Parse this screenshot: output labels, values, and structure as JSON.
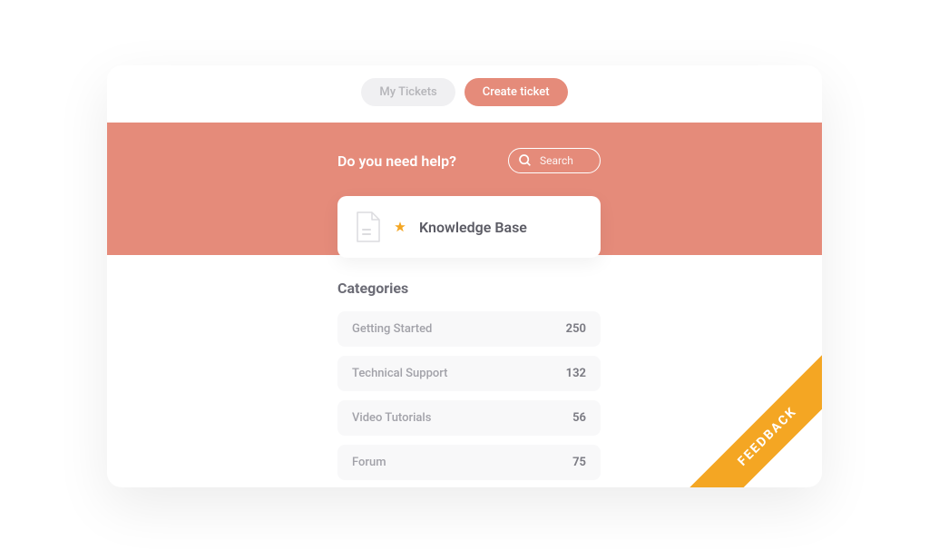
{
  "header": {
    "my_tickets": "My Tickets",
    "create_ticket": "Create ticket"
  },
  "hero": {
    "title": "Do you need help?",
    "search_placeholder": "Search"
  },
  "knowledge_base": {
    "title": "Knowledge Base"
  },
  "categories": {
    "heading": "Categories",
    "items": [
      {
        "label": "Getting Started",
        "count": "250"
      },
      {
        "label": "Technical Support",
        "count": "132"
      },
      {
        "label": "Video Tutorials",
        "count": "56"
      },
      {
        "label": "Forum",
        "count": "75"
      }
    ]
  },
  "feedback": {
    "label": "FEEDBACK"
  }
}
